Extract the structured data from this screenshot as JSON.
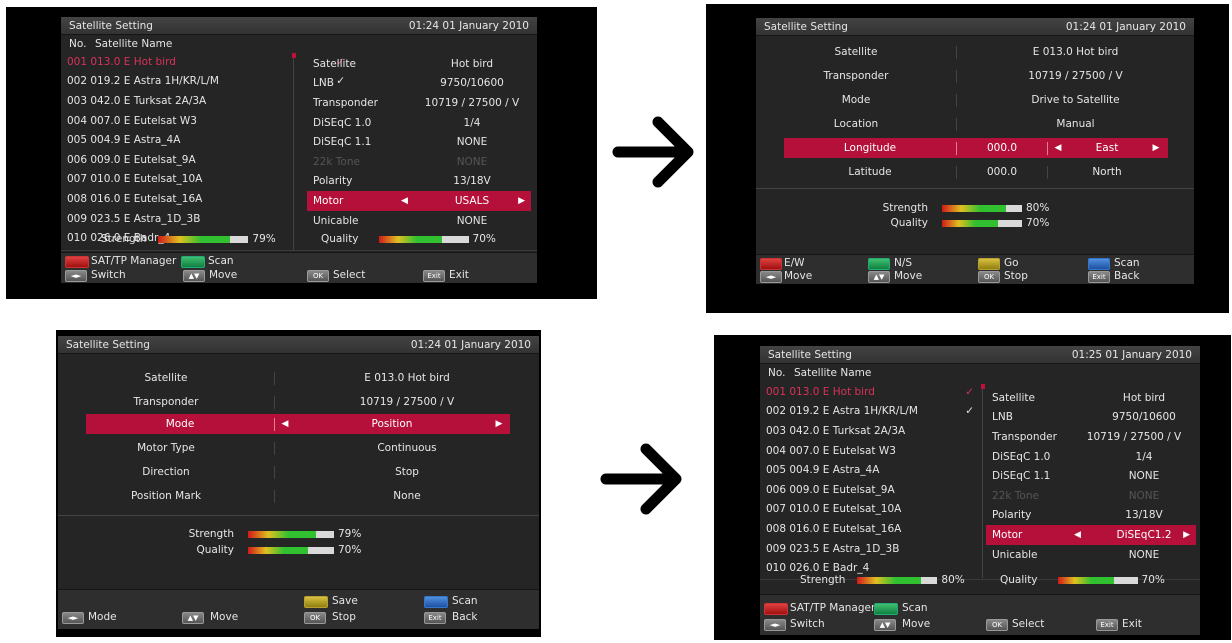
{
  "title": "Satellite Setting",
  "panel1": {
    "time": "01:24 01 January 2010",
    "header_no": "No.",
    "header_name": "Satellite Name",
    "satellites": [
      {
        "text": "001  013.0  E  Hot bird",
        "check": "✓"
      },
      {
        "text": "002  019.2  E  Astra 1H/KR/L/M",
        "check": "✓"
      },
      {
        "text": "003  042.0  E  Turksat 2A/3A",
        "check": ""
      },
      {
        "text": "004  007.0  E  Eutelsat W3",
        "check": ""
      },
      {
        "text": "005  004.9  E  Astra_4A",
        "check": ""
      },
      {
        "text": "006  009.0  E  Eutelsat_9A",
        "check": ""
      },
      {
        "text": "007  010.0  E  Eutelsat_10A",
        "check": ""
      },
      {
        "text": "008  016.0  E  Eutelsat_16A",
        "check": ""
      },
      {
        "text": "009  023.5  E  Astra_1D_3B",
        "check": ""
      },
      {
        "text": "010  026.0  E  Badr_4",
        "check": ""
      }
    ],
    "params": [
      {
        "k": "Satellite",
        "v": "Hot bird"
      },
      {
        "k": "LNB",
        "v": "9750/10600"
      },
      {
        "k": "Transponder",
        "v": "10719 / 27500 / V"
      },
      {
        "k": "DiSEqC 1.0",
        "v": "1/4"
      },
      {
        "k": "DiSEqC 1.1",
        "v": "NONE"
      },
      {
        "k": "22k Tone",
        "v": "NONE"
      },
      {
        "k": "Polarity",
        "v": "13/18V"
      },
      {
        "k": "Motor",
        "v": "USALS"
      },
      {
        "k": "Unicable",
        "v": "NONE"
      }
    ],
    "strength_label": "Strength",
    "strength_value": "79%",
    "strength": 0.79,
    "quality_label": "Quality",
    "quality_value": "70%",
    "quality": 0.7,
    "footer": {
      "red": "SAT/TP Manager",
      "green": "Scan",
      "lr_key": "◄►",
      "lr": "Switch",
      "ud_key": "▲▼",
      "ud": "Move",
      "ok_key": "OK",
      "ok": "Select",
      "exit_key": "Exit",
      "exit": "Exit"
    }
  },
  "panel2": {
    "time": "01:24 01 January 2010",
    "rows": [
      {
        "k": "Satellite",
        "v": "E 013.0 Hot bird"
      },
      {
        "k": "Transponder",
        "v": "10719 / 27500 / V"
      },
      {
        "k": "Mode",
        "v": "Drive to Satellite"
      },
      {
        "k": "Location",
        "v": "Manual"
      },
      {
        "k": "Longitude",
        "v": "000.0",
        "v2": "East"
      },
      {
        "k": "Latitude",
        "v": "000.0",
        "v2": "North"
      }
    ],
    "strength_label": "Strength",
    "strength_value": "80%",
    "strength": 0.8,
    "quality_label": "Quality",
    "quality_value": "70%",
    "quality": 0.7,
    "footer": {
      "red": "E/W",
      "green": "N/S",
      "yellow": "Go",
      "blue": "Scan",
      "lr_key": "◄►",
      "lr": "Move",
      "ud_key": "▲▼",
      "ud": "Move",
      "ok_key": "OK",
      "ok": "Stop",
      "exit_key": "Exit",
      "exit": "Back"
    }
  },
  "panel3": {
    "time": "01:24 01 January 2010",
    "rows": [
      {
        "k": "Satellite",
        "v": "E 013.0 Hot bird"
      },
      {
        "k": "Transponder",
        "v": "10719 / 27500 / V"
      },
      {
        "k": "Mode",
        "v": "Position"
      },
      {
        "k": "Motor Type",
        "v": "Continuous"
      },
      {
        "k": "Direction",
        "v": "Stop"
      },
      {
        "k": "Position Mark",
        "v": "None"
      }
    ],
    "strength_label": "Strength",
    "strength_value": "79%",
    "strength": 0.79,
    "quality_label": "Quality",
    "quality_value": "70%",
    "quality": 0.7,
    "footer": {
      "yellow": "Save",
      "blue": "Scan",
      "lr_key": "◄►",
      "lr": "Mode",
      "ud_key": "▲▼",
      "ud": "Move",
      "ok_key": "OK",
      "ok": "Stop",
      "exit_key": "Exit",
      "exit": "Back"
    }
  },
  "panel4": {
    "time": "01:25 01 January 2010",
    "header_no": "No.",
    "header_name": "Satellite Name",
    "satellites": [
      {
        "text": "001  013.0  E  Hot bird",
        "check": "✓"
      },
      {
        "text": "002  019.2  E  Astra 1H/KR/L/M",
        "check": "✓"
      },
      {
        "text": "003  042.0  E  Turksat 2A/3A",
        "check": ""
      },
      {
        "text": "004  007.0  E  Eutelsat W3",
        "check": ""
      },
      {
        "text": "005  004.9  E  Astra_4A",
        "check": ""
      },
      {
        "text": "006  009.0  E  Eutelsat_9A",
        "check": ""
      },
      {
        "text": "007  010.0  E  Eutelsat_10A",
        "check": ""
      },
      {
        "text": "008  016.0  E  Eutelsat_16A",
        "check": ""
      },
      {
        "text": "009  023.5  E  Astra_1D_3B",
        "check": ""
      },
      {
        "text": "010  026.0  E  Badr_4",
        "check": ""
      }
    ],
    "params": [
      {
        "k": "Satellite",
        "v": "Hot bird"
      },
      {
        "k": "LNB",
        "v": "9750/10600"
      },
      {
        "k": "Transponder",
        "v": "10719 / 27500 / V"
      },
      {
        "k": "DiSEqC 1.0",
        "v": "1/4"
      },
      {
        "k": "DiSEqC 1.1",
        "v": "NONE"
      },
      {
        "k": "22k Tone",
        "v": "NONE"
      },
      {
        "k": "Polarity",
        "v": "13/18V"
      },
      {
        "k": "Motor",
        "v": "DiSEqC1.2"
      },
      {
        "k": "Unicable",
        "v": "NONE"
      }
    ],
    "strength_label": "Strength",
    "strength_value": "80%",
    "strength": 0.8,
    "quality_label": "Quality",
    "quality_value": "70%",
    "quality": 0.7,
    "footer": {
      "red": "SAT/TP Manager",
      "green": "Scan",
      "lr_key": "◄►",
      "lr": "Switch",
      "ud_key": "▲▼",
      "ud": "Move",
      "ok_key": "OK",
      "ok": "Select",
      "exit_key": "Exit",
      "exit": "Exit"
    }
  },
  "colors": {
    "highlight": "#b4103a",
    "selected_text": "#d8325a"
  },
  "icons": {
    "next": "arrow-right-icon",
    "left": "triangle-left-icon",
    "right": "triangle-right-icon"
  }
}
